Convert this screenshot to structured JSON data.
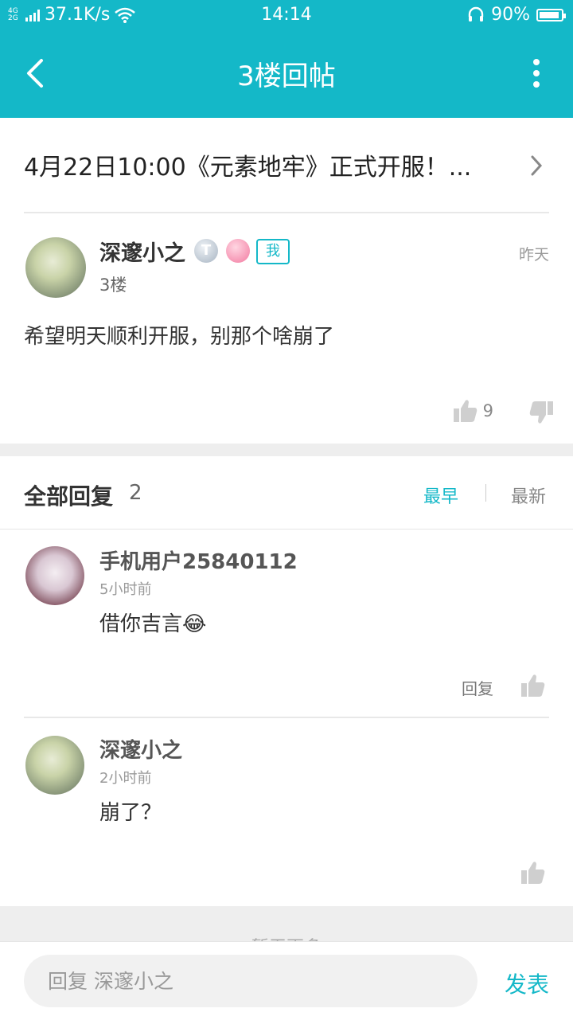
{
  "statusbar": {
    "network": "4G 2G",
    "speed": "37.1K/s",
    "time": "14:14",
    "battery": "90%"
  },
  "header": {
    "title": "3楼回帖"
  },
  "topic": {
    "title": "4月22日10:00《元素地牢》正式开服！..."
  },
  "post": {
    "author": "深邃小之",
    "badge_level": "T",
    "badge_me": "我",
    "floor": "3楼",
    "time": "昨天",
    "content": "希望明天顺利开服，别那个啥崩了",
    "likes": "9"
  },
  "replies": {
    "title": "全部回复",
    "count": "2",
    "sort_early": "最早",
    "sort_new": "最新",
    "items": [
      {
        "author": "手机用户25840112",
        "time": "5小时前",
        "content": "借你吉言😂",
        "reply_label": "回复"
      },
      {
        "author": "深邃小之",
        "time": "2小时前",
        "content": "崩了？"
      }
    ]
  },
  "footer": {
    "more_text": "暂无更多",
    "input_placeholder": "回复 深邃小之",
    "send_label": "发表"
  },
  "colors": {
    "accent": "#14b8c8",
    "band": "#eeeeee"
  }
}
